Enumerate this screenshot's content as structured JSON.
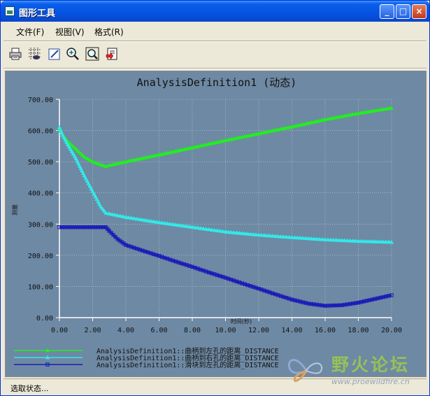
{
  "window": {
    "title": "图形工具",
    "minimize": "_",
    "maximize": "□",
    "close": "×"
  },
  "menu": [
    {
      "label": "文件(F)"
    },
    {
      "label": "视图(V)"
    },
    {
      "label": "格式(R)"
    }
  ],
  "toolbar": [
    {
      "name": "print",
      "icon": "printer-icon"
    },
    {
      "name": "grid",
      "icon": "grid-icon"
    },
    {
      "name": "edit",
      "icon": "edit-icon"
    },
    {
      "name": "zoom-in",
      "icon": "zoom-in-icon"
    },
    {
      "name": "zoom-fit",
      "icon": "zoom-window-icon"
    },
    {
      "name": "export",
      "icon": "export-icon"
    }
  ],
  "chart_data": {
    "type": "line",
    "title": "AnalysisDefinition1 (动态)",
    "xlabel": "时间(秒)",
    "ylabel": "测量",
    "xlim": [
      0,
      20
    ],
    "ylim": [
      0,
      700
    ],
    "x_ticks": [
      0,
      2,
      4,
      6,
      8,
      10,
      12,
      14,
      16,
      18,
      20
    ],
    "x_tick_labels": [
      "0.00",
      "2.00",
      "4.00",
      "6.00",
      "8.00",
      "10.00",
      "12.00",
      "14.00",
      "16.00",
      "18.00",
      "20.00"
    ],
    "y_ticks": [
      0,
      100,
      200,
      300,
      400,
      500,
      600,
      700
    ],
    "y_tick_labels": [
      "0.00",
      "100.00",
      "200.00",
      "300.00",
      "400.00",
      "500.00",
      "600.00",
      "700.00"
    ],
    "grid": true,
    "legend_position": "bottom-left",
    "background": "#6e89a3",
    "series": [
      {
        "name": "AnalysisDefinition1::曲柄到左孔的距离_DISTANCE",
        "color": "#22ee22",
        "marker": "triangle",
        "x": [
          0,
          0.2,
          0.5,
          1,
          1.5,
          2,
          2.5,
          2.8,
          3,
          4,
          6,
          8,
          10,
          12,
          14,
          16,
          18,
          20
        ],
        "y": [
          605,
          585,
          565,
          540,
          515,
          500,
          490,
          485,
          488,
          500,
          522,
          545,
          568,
          590,
          612,
          635,
          655,
          672
        ]
      },
      {
        "name": "AnalysisDefinition1::曲柄到右孔的距离_DISTANCE",
        "color": "#33e8e8",
        "marker": "triangle",
        "x": [
          0,
          0.2,
          0.5,
          1,
          1.5,
          2,
          2.5,
          2.8,
          3,
          4,
          6,
          8,
          10,
          12,
          14,
          16,
          18,
          20
        ],
        "y": [
          610,
          585,
          555,
          510,
          455,
          405,
          355,
          335,
          333,
          322,
          305,
          290,
          275,
          265,
          257,
          250,
          245,
          242
        ]
      },
      {
        "name": "AnalysisDefinition1::滑块到左孔的距离_DISTANCE",
        "color": "#1a1ab8",
        "marker": "square",
        "x": [
          0,
          0.5,
          1,
          1.5,
          2,
          2.5,
          2.8,
          3,
          3.5,
          4,
          5,
          6,
          7,
          8,
          9,
          10,
          11,
          12,
          13,
          14,
          15,
          16,
          17,
          18,
          19,
          20
        ],
        "y": [
          290,
          290,
          290,
          290,
          290,
          290,
          290,
          278,
          252,
          233,
          215,
          198,
          180,
          163,
          145,
          128,
          110,
          93,
          75,
          58,
          45,
          38,
          40,
          48,
          60,
          72
        ]
      }
    ]
  },
  "status": {
    "text": "选取状态..."
  },
  "watermark": {
    "title": "野火论坛",
    "url": "www.proewildfire.cn"
  }
}
